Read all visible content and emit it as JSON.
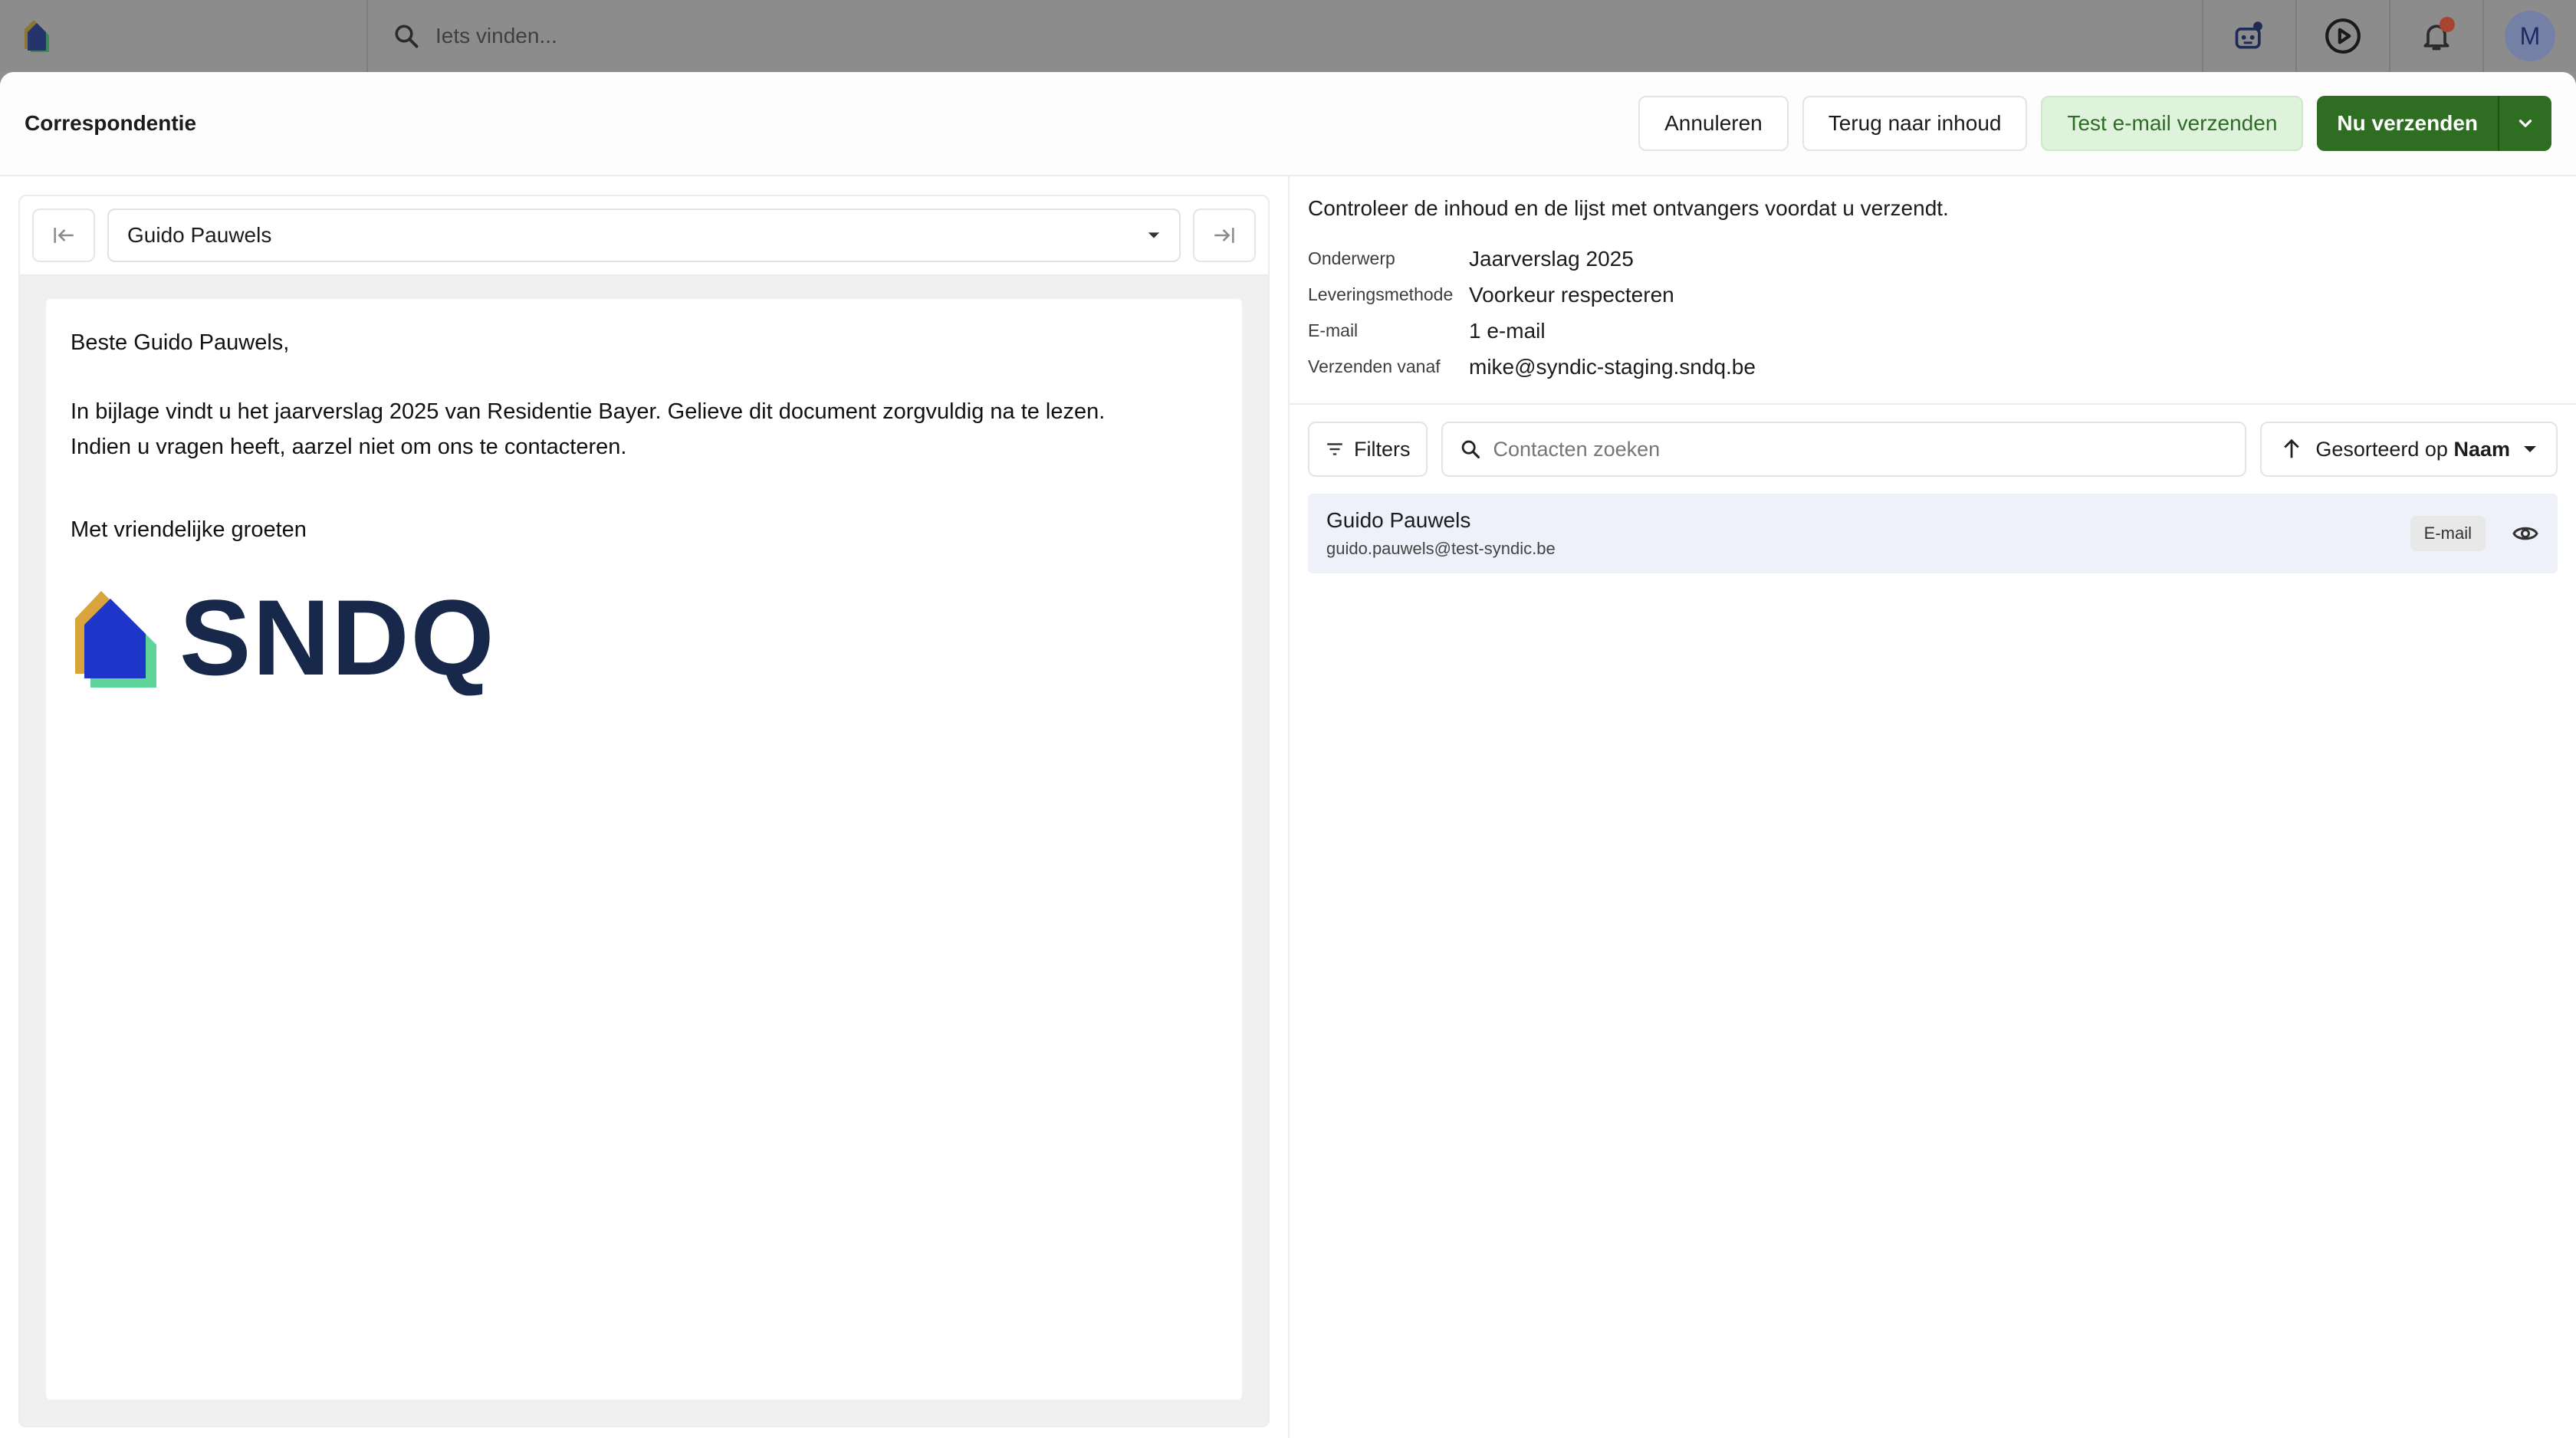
{
  "topbar": {
    "search_placeholder": "Iets vinden...",
    "avatar_initial": "M",
    "colors": {
      "notification_dot": "#a84532"
    }
  },
  "modal": {
    "title": "Correspondentie",
    "actions": {
      "cancel": "Annuleren",
      "back": "Terug naar inhoud",
      "test": "Test e-mail verzenden",
      "send": "Nu verzenden"
    },
    "colors": {
      "send_button": "#2e6d22",
      "test_button_bg": "#dff3dc"
    }
  },
  "preview": {
    "recipient": "Guido Pauwels",
    "email": {
      "greeting": "Beste Guido Pauwels,",
      "line1": "In bijlage vindt u het jaarverslag 2025 van Residentie Bayer. Gelieve dit document zorgvuldig na te lezen.",
      "line2": "Indien u vragen heeft, aarzel niet om ons te contacteren.",
      "closing": "Met vriendelijke groeten",
      "logo_text": "SNDQ"
    }
  },
  "summary": {
    "intro": "Controleer de inhoud en de lijst met ontvangers voordat u verzendt.",
    "rows": [
      {
        "key": "Onderwerp",
        "value": "Jaarverslag 2025"
      },
      {
        "key": "Leveringsmethode",
        "value": "Voorkeur respecteren"
      },
      {
        "key": "E-mail",
        "value": "1 e-mail"
      },
      {
        "key": "Verzenden vanaf",
        "value": "mike@syndic-staging.sndq.be"
      }
    ]
  },
  "recipients": {
    "filters_label": "Filters",
    "search_placeholder": "Contacten zoeken",
    "sort_prefix": "Gesorteerd op",
    "sort_field": "Naam",
    "items": [
      {
        "name": "Guido Pauwels",
        "email": "guido.pauwels@test-syndic.be",
        "method": "E-mail"
      }
    ]
  }
}
